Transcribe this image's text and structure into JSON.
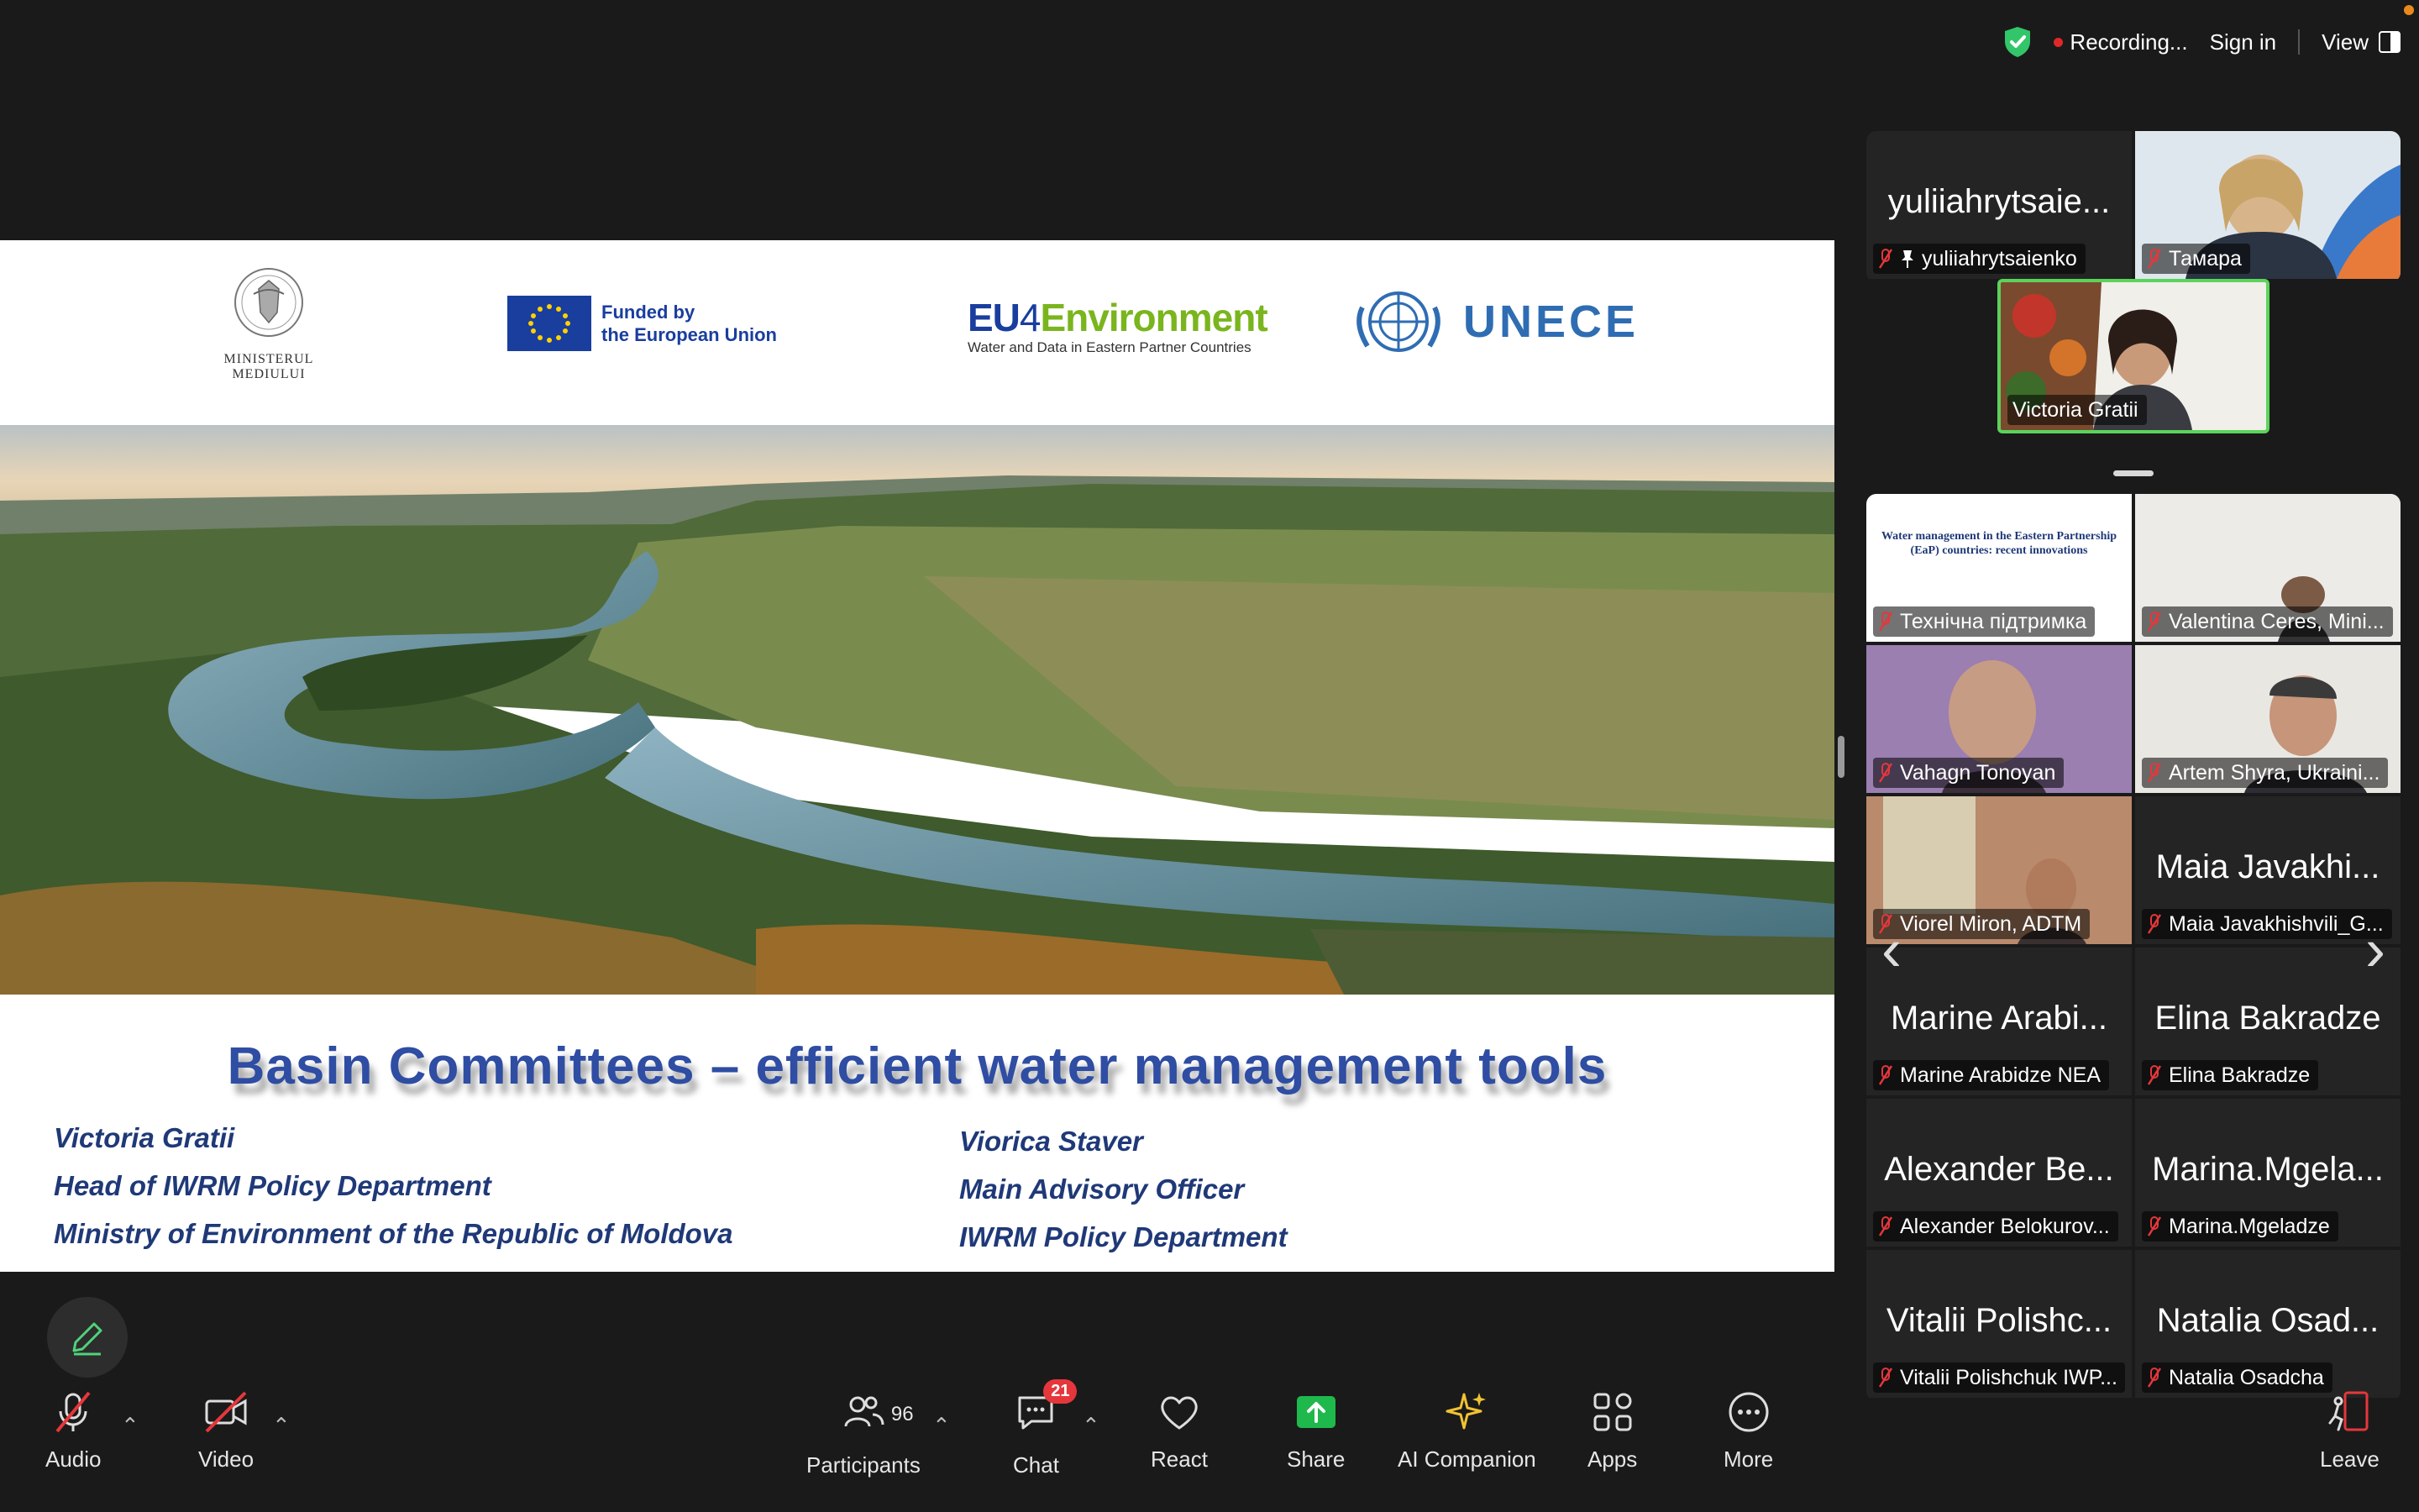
{
  "status_bar": {
    "recording_label": "Recording...",
    "sign_in_label": "Sign in",
    "view_label": "View"
  },
  "slide": {
    "ministry_logo_text": [
      "MINISTERUL",
      "MEDIULUI"
    ],
    "eu_logo_text": [
      "Funded by",
      "the European Union"
    ],
    "eu4_logo_main": [
      "EU",
      "4",
      "Environment"
    ],
    "eu4_logo_sub": "Water and Data in Eastern Partner Countries",
    "unece_logo_text": "UNECE",
    "title": "Basin Committees – efficient water management tools",
    "author_left": [
      "Victoria Gratii",
      "Head of IWRM Policy Department",
      "Ministry of Environment of the Republic of Moldova"
    ],
    "author_right": [
      "Viorica Staver",
      "Main Advisory Officer",
      "IWRM Policy Department"
    ]
  },
  "participants_top": [
    {
      "display_name": "yuliiahrytsaie...",
      "label": "yuliiahrytsaienko",
      "pinned": true,
      "video": false
    },
    {
      "display_name": "",
      "label": "Тамара",
      "pinned": false,
      "video": true
    },
    {
      "display_name": "",
      "label": "Victoria Gratii",
      "pinned": false,
      "video": true,
      "active_speaker": true
    }
  ],
  "participants_grid": [
    {
      "display_name": "",
      "label": "Технічна підтримка",
      "video": true,
      "shared_thumb_text": "Water management in the Eastern Partnership (EaP) countries: recent innovations"
    },
    {
      "display_name": "",
      "label": "Valentina Ceres, Mini...",
      "video": true
    },
    {
      "display_name": "",
      "label": "Vahagn Tonoyan",
      "video": true
    },
    {
      "display_name": "",
      "label": "Artem Shyra, Ukraini...",
      "video": true
    },
    {
      "display_name": "",
      "label": "Viorel Miron, ADTM",
      "video": true
    },
    {
      "display_name": "Maia Javakhi...",
      "label": "Maia Javakhishvili_G...",
      "video": false
    },
    {
      "display_name": "Marine Arabi...",
      "label": "Marine Arabidze NEA",
      "video": false
    },
    {
      "display_name": "Elina Bakradze",
      "label": "Elina Bakradze",
      "video": false
    },
    {
      "display_name": "Alexander Be...",
      "label": "Alexander Belokurov...",
      "video": false
    },
    {
      "display_name": "Marina.Mgela...",
      "label": "Marina.Mgeladze",
      "video": false
    },
    {
      "display_name": "Vitalii Polishc...",
      "label": "Vitalii Polishchuk IWP...",
      "video": false
    },
    {
      "display_name": "Natalia Osad...",
      "label": "Natalia Osadcha",
      "video": false
    }
  ],
  "toolbar": {
    "audio": "Audio",
    "video": "Video",
    "participants": "Participants",
    "participants_count": "96",
    "chat": "Chat",
    "chat_badge": "21",
    "react": "React",
    "share": "Share",
    "ai_companion": "AI Companion",
    "apps": "Apps",
    "more": "More",
    "leave": "Leave"
  },
  "colors": {
    "accent_green": "#5bd35b",
    "share_green": "#1fb84c",
    "record_red": "#e02828",
    "badge_red": "#e5373b",
    "slide_title_blue": "#2e4da3"
  }
}
